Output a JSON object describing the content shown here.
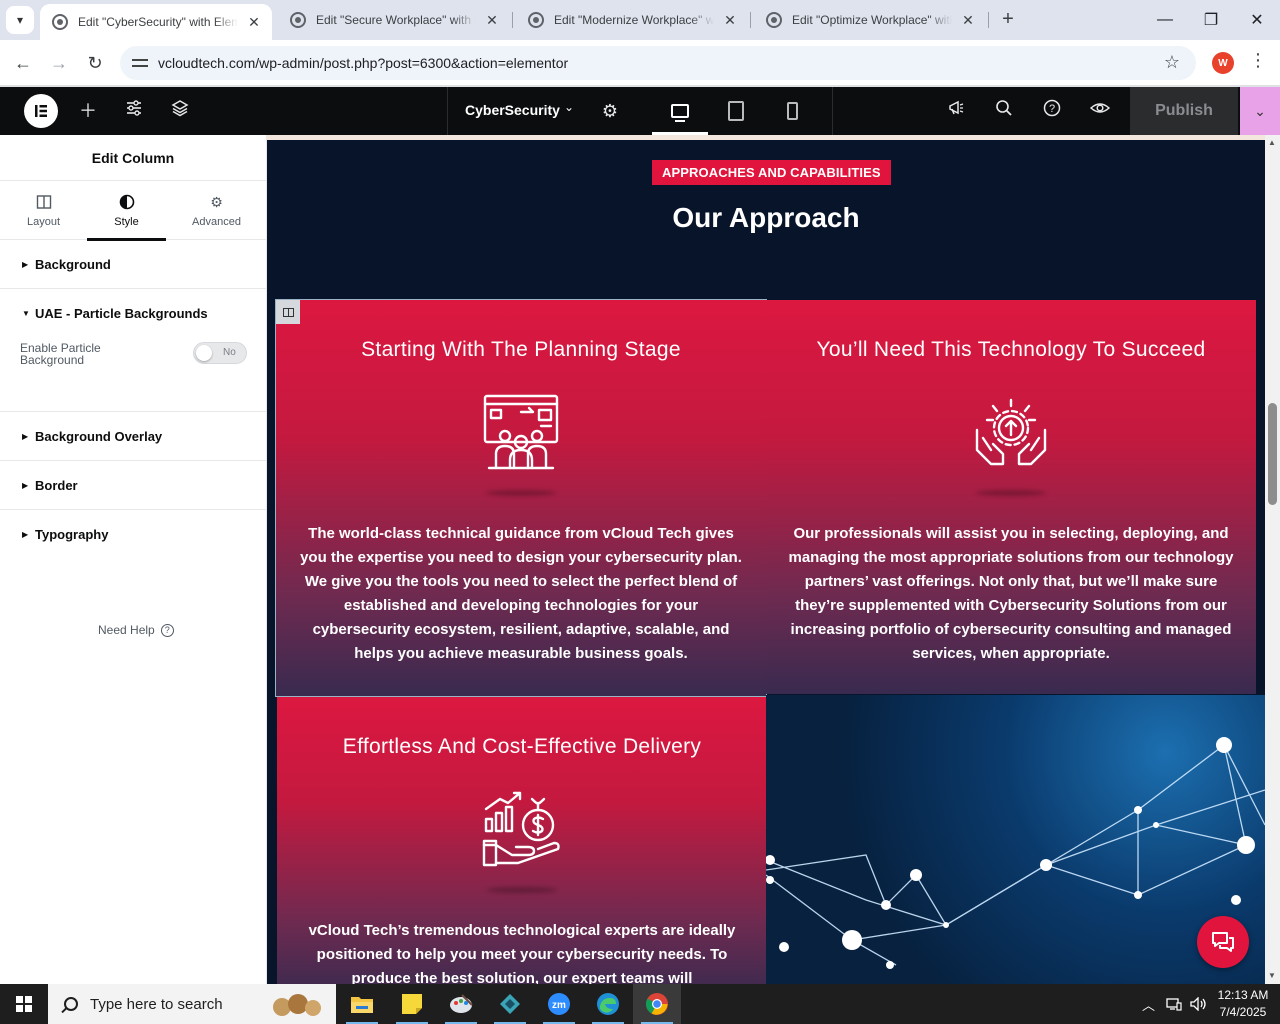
{
  "browser": {
    "tabs": [
      {
        "title": "Edit \"CyberSecurity\" with Elementor",
        "active": true
      },
      {
        "title": "Edit \"Secure Workplace\" with Elementor",
        "active": false
      },
      {
        "title": "Edit \"Modernize Workplace\" with Elementor",
        "active": false
      },
      {
        "title": "Edit \"Optimize Workplace\" with Elementor",
        "active": false
      }
    ],
    "url": "vcloudtech.com/wp-admin/post.php?post=6300&action=elementor",
    "profile_initial": "W"
  },
  "editor": {
    "logo": "E",
    "document_name": "CyberSecurity",
    "publish_label": "Publish"
  },
  "panel": {
    "title": "Edit Column",
    "tabs": {
      "layout": "Layout",
      "style": "Style",
      "advanced": "Advanced"
    },
    "sections": {
      "background": "Background",
      "particles": "UAE - Particle Backgrounds",
      "overlay": "Background Overlay",
      "border": "Border",
      "typography": "Typography"
    },
    "particle_control": {
      "label": "Enable Particle Background",
      "value": "No"
    },
    "need_help": "Need Help"
  },
  "page": {
    "badge": "APPROACHES AND CAPABILITIES",
    "heading": "Our Approach",
    "cards": [
      {
        "title": "Starting With The Planning Stage",
        "icon": "planning-icon",
        "body": "The world-class technical guidance from vCloud Tech gives you the expertise you need to design your cybersecurity plan. We give you the tools you need to select the perfect blend of established and developing technologies for your cybersecurity ecosystem, resilient, adaptive, scalable, and helps you achieve measurable business goals."
      },
      {
        "title": "You’ll Need This Technology To Succeed",
        "icon": "technology-hands-icon",
        "body": "Our professionals will assist you in selecting, deploying, and managing the most appropriate solutions from our technology partners’ vast offerings. Not only that, but we’ll make sure they’re supplemented with Cybersecurity Solutions from our increasing portfolio of cybersecurity consulting and managed services, when appropriate."
      },
      {
        "title": "Effortless And Cost-Effective Delivery",
        "icon": "cost-growth-icon",
        "body": "vCloud Tech’s tremendous technological experts are ideally positioned to help you meet your cybersecurity needs. To produce the best solution, our expert teams will"
      }
    ]
  },
  "taskbar": {
    "search_placeholder": "Type here to search",
    "time": "12:13 AM",
    "date": "7/4/2025"
  },
  "colors": {
    "accent_red": "#e0143c",
    "canvas_dark": "#08142a",
    "publish_more": "#e8a2e8"
  }
}
